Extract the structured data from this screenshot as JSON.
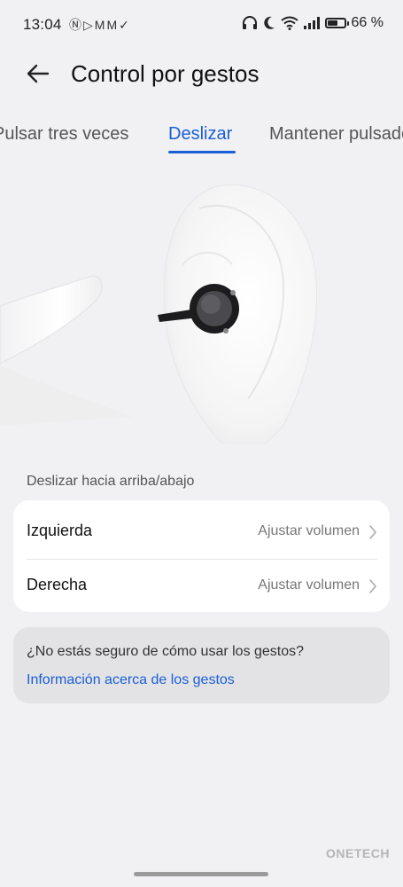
{
  "status_bar": {
    "time": "13:04",
    "left_icons": [
      "nfc-icon",
      "play-icon",
      "mail-icon",
      "mail-icon",
      "check-icon"
    ],
    "right_icons": [
      "headphones-icon",
      "moon-icon",
      "wifi-icon",
      "signal-icon",
      "battery-icon"
    ],
    "battery_percent": "66 %",
    "battery_level": 0.66
  },
  "header": {
    "title": "Control por gestos"
  },
  "tabs": [
    {
      "label": "Pulsar tres veces",
      "active": false
    },
    {
      "label": "Deslizar",
      "active": true
    },
    {
      "label": "Mantener pulsado",
      "active": false
    }
  ],
  "section": {
    "label": "Deslizar hacia arriba/abajo"
  },
  "settings": [
    {
      "label": "Izquierda",
      "value": "Ajustar volumen"
    },
    {
      "label": "Derecha",
      "value": "Ajustar volumen"
    }
  ],
  "help": {
    "question": "¿No estás seguro de cómo usar los gestos?",
    "link": "Información acerca de los gestos"
  },
  "watermark": "ONETECH",
  "colors": {
    "accent": "#1a5fd6",
    "background": "#f1f1f3",
    "card": "#ffffff",
    "help_card": "#e3e3e6"
  }
}
